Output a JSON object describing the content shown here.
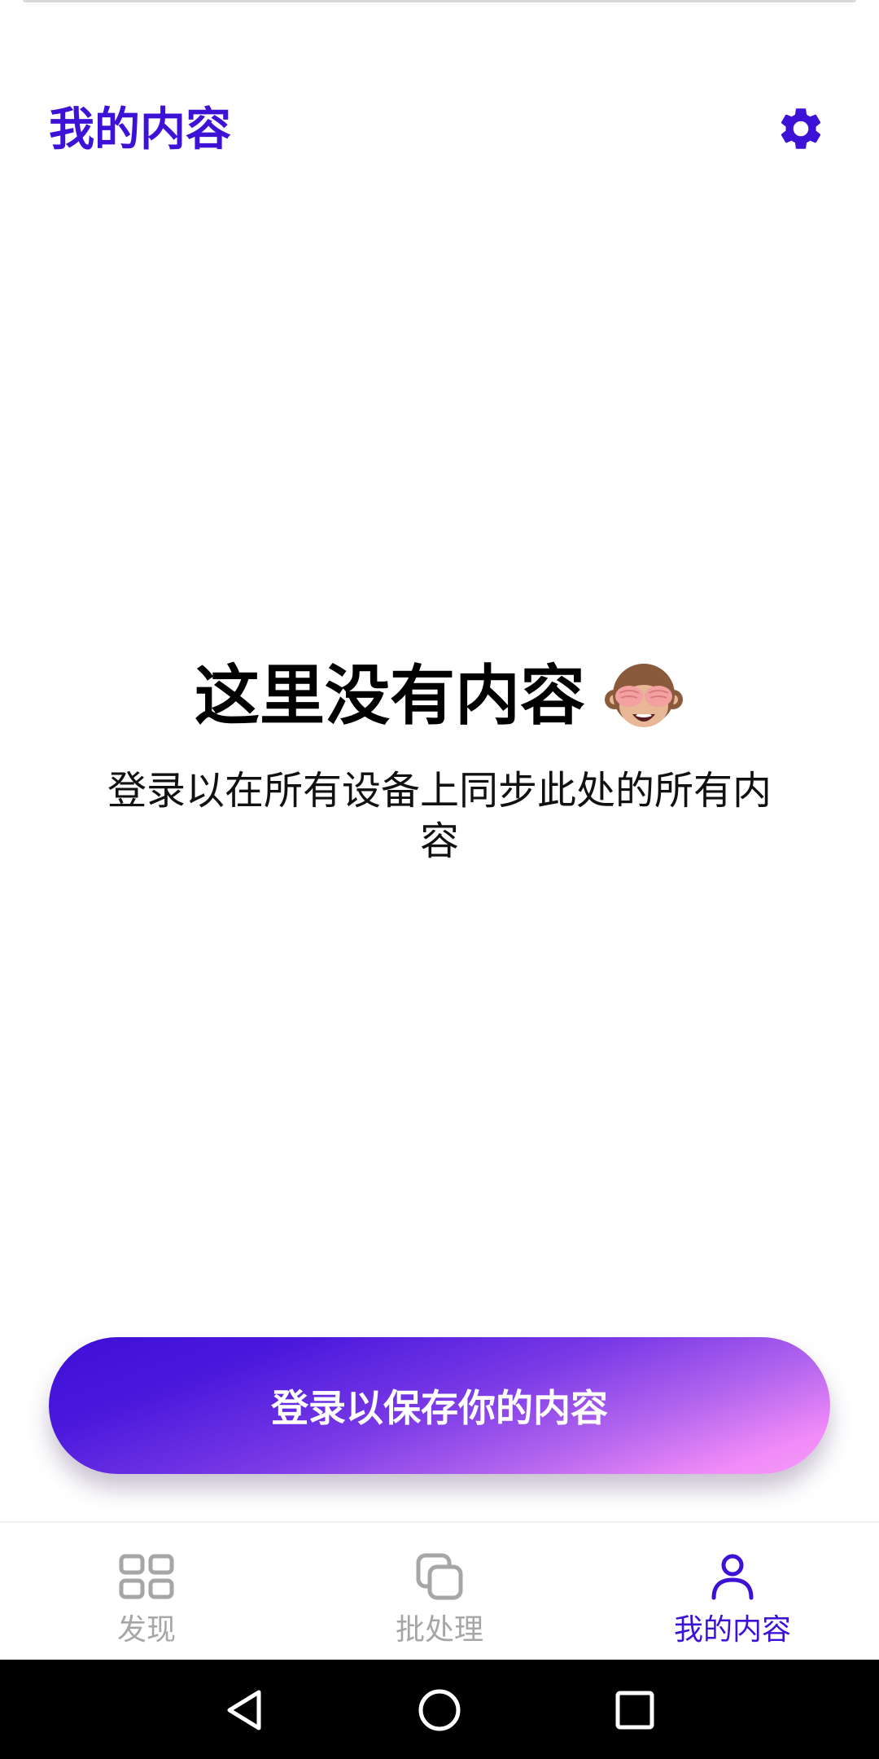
{
  "header": {
    "title": "我的内容",
    "settings_icon": "gear-icon"
  },
  "empty_state": {
    "title": "这里没有内容",
    "emoji_icon": "see-no-evil-monkey-icon",
    "subtitle": "登录以在所有设备上同步此处的所有内容"
  },
  "cta": {
    "label": "登录以保存你的内容"
  },
  "bottom_nav": {
    "items": [
      {
        "label": "发现",
        "icon": "grid-icon",
        "active": false
      },
      {
        "label": "批处理",
        "icon": "stack-icon",
        "active": false
      },
      {
        "label": "我的内容",
        "icon": "person-icon",
        "active": true
      }
    ]
  },
  "system_nav": {
    "back_icon": "back-triangle-icon",
    "home_icon": "home-circle-icon",
    "recents_icon": "recents-square-icon"
  },
  "colors": {
    "accent": "#3d12d6",
    "inactive": "#a6a6a6",
    "gradient_start": "#3f0fd8",
    "gradient_end": "#f49af8"
  }
}
